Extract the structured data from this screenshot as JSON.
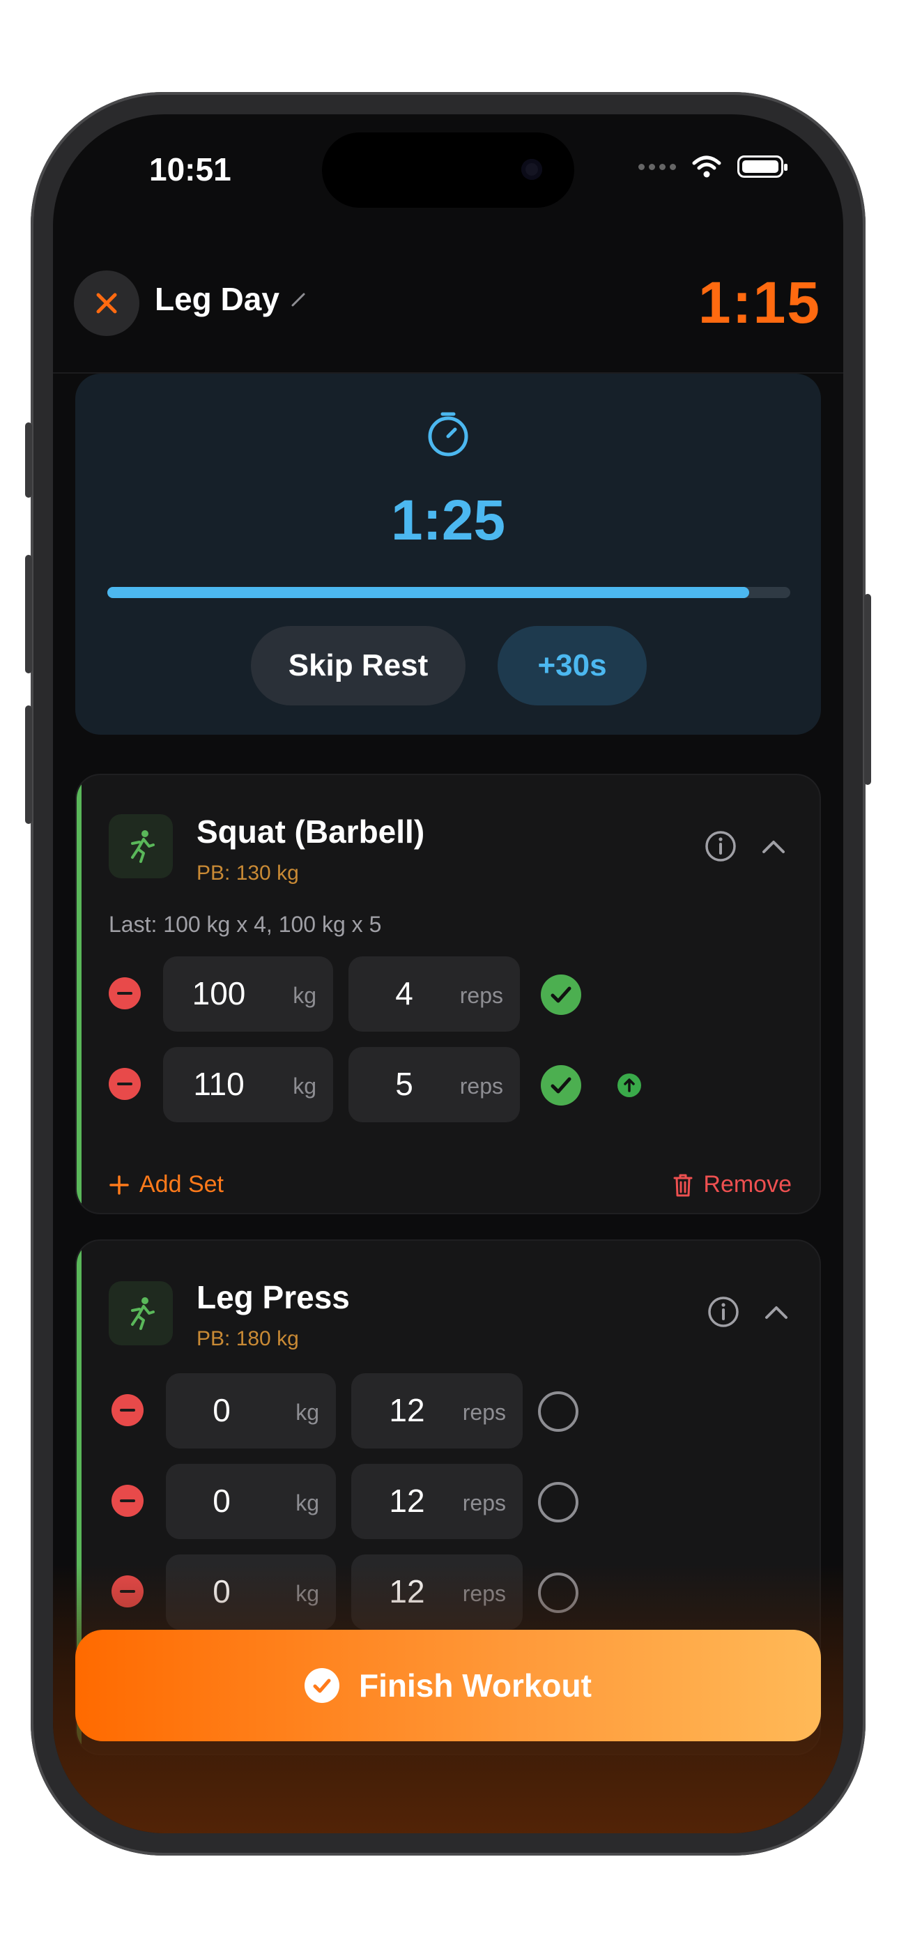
{
  "status": {
    "time": "10:51"
  },
  "header": {
    "title": "Leg Day",
    "elapsed": "1:15"
  },
  "rest": {
    "time": "1:25",
    "progress": 0.94,
    "skip_label": "Skip Rest",
    "add_label": "+30s"
  },
  "exercises": [
    {
      "name": "Squat (Barbell)",
      "pb": "PB: 130 kg",
      "last": "Last: 100 kg x 4, 100 kg x 5",
      "sets": [
        {
          "weight": "100",
          "weight_unit": "kg",
          "reps": "4",
          "reps_unit": "reps",
          "done": true
        },
        {
          "weight": "110",
          "weight_unit": "kg",
          "reps": "5",
          "reps_unit": "reps",
          "done": true,
          "pr": true
        }
      ],
      "add_set_label": "Add Set",
      "remove_label": "Remove"
    },
    {
      "name": "Leg Press",
      "pb": "PB: 180 kg",
      "sets": [
        {
          "weight": "0",
          "weight_unit": "kg",
          "reps": "12",
          "reps_unit": "reps",
          "done": false
        },
        {
          "weight": "0",
          "weight_unit": "kg",
          "reps": "12",
          "reps_unit": "reps",
          "done": false
        },
        {
          "weight": "0",
          "weight_unit": "kg",
          "reps": "12",
          "reps_unit": "reps",
          "done": false
        }
      ]
    }
  ],
  "finish": {
    "label": "Finish Workout"
  },
  "colors": {
    "accent": "#ff6a10",
    "rest": "#4cb8f0",
    "success": "#4caf50",
    "danger": "#e84a4a",
    "pb": "#c98a35"
  }
}
